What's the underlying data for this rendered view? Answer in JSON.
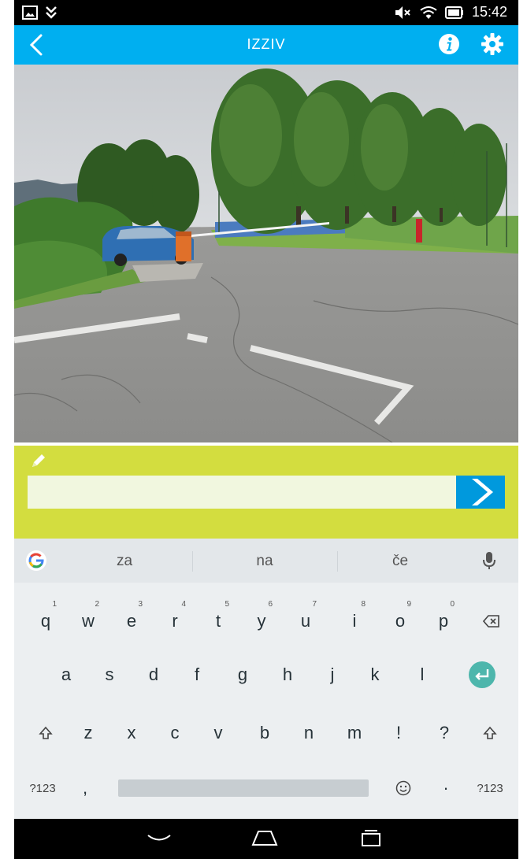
{
  "status_bar": {
    "time": "15:42",
    "icons": [
      "image-notification-icon",
      "download-notification-icon",
      "volume-muted-icon",
      "wifi-icon",
      "battery-icon"
    ]
  },
  "app_bar": {
    "title": "IZZIV",
    "back_icon": "chevron-left-icon",
    "info_icon": "info-icon",
    "settings_icon": "gear-icon",
    "color": "#00aff0"
  },
  "answer_panel": {
    "input_value": "",
    "pencil_icon": "pencil-icon",
    "submit_icon": "chevron-right-icon",
    "color": "#d3dd3f"
  },
  "keyboard": {
    "suggestions": [
      "za",
      "na",
      "če"
    ],
    "row1": [
      {
        "key": "q",
        "hint": "1"
      },
      {
        "key": "w",
        "hint": "2"
      },
      {
        "key": "e",
        "hint": "3"
      },
      {
        "key": "r",
        "hint": "4"
      },
      {
        "key": "t",
        "hint": "5"
      },
      {
        "key": "y",
        "hint": "6"
      },
      {
        "key": "u",
        "hint": "7"
      },
      {
        "key": "i",
        "hint": "8"
      },
      {
        "key": "o",
        "hint": "9"
      },
      {
        "key": "p",
        "hint": "0"
      }
    ],
    "row2": [
      "a",
      "s",
      "d",
      "f",
      "g",
      "h",
      "j",
      "k",
      "l"
    ],
    "row3": [
      "z",
      "x",
      "c",
      "v",
      "b",
      "n",
      "m",
      "!",
      "?"
    ],
    "row4": {
      "symbols_left": "?123",
      "comma": ",",
      "period": "·",
      "symbols_right": "?123"
    },
    "enter_color": "#4db6ac"
  },
  "nav_bar": {
    "icons": [
      "nav-back-icon",
      "nav-home-icon",
      "nav-recents-icon"
    ]
  }
}
